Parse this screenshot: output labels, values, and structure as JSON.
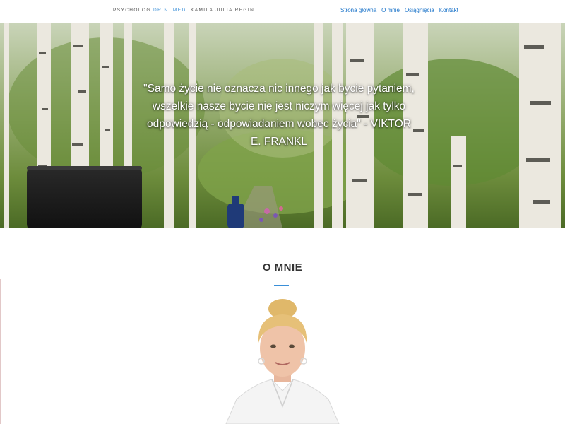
{
  "header": {
    "brand_prefix": "PSYCHOLOG",
    "brand_title": "DR N. MED.",
    "brand_name": "KAMILA JULIA REGIN",
    "nav": [
      {
        "label": "Strona główna"
      },
      {
        "label": "O mnie"
      },
      {
        "label": "Osiągnięcia"
      },
      {
        "label": "Kontakt"
      }
    ]
  },
  "hero": {
    "quote": "\"Samo życie nie oznacza nic innego jak bycie pytaniem, wszelkie nasze bycie nie jest niczym więcej jak tylko odpowiedzią - odpowiadaniem wobec życia\" - VIKTOR E. FRANKL"
  },
  "about": {
    "title": "O MNIE"
  },
  "colors": {
    "accent": "#3a8fd8",
    "nav_link": "#1a73c9"
  }
}
